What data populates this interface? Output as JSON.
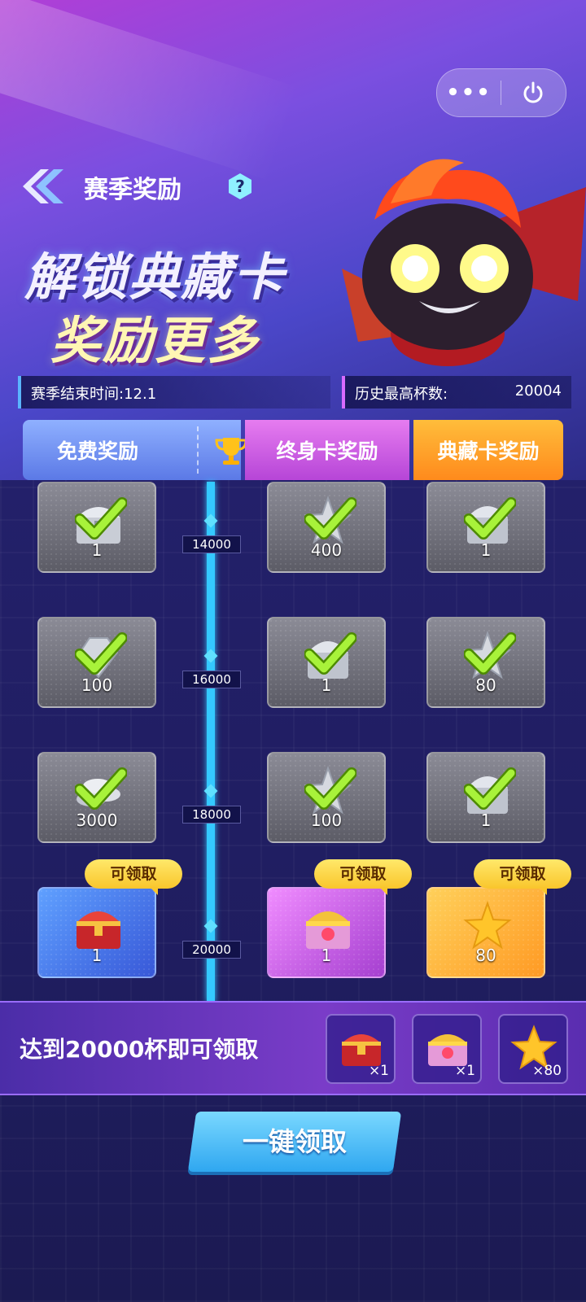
{
  "capsule": {
    "more_label": "•••",
    "power_icon": "power-icon"
  },
  "header": {
    "title": "赛季奖励",
    "help_label": "?"
  },
  "banner": {
    "line1": "解锁典藏卡",
    "line2": "奖励更多"
  },
  "info": {
    "season_end": "赛季结束时间:12.1",
    "best_label": "历史最高杯数:",
    "best_value": "20004"
  },
  "tabs": {
    "free": "免费奖励",
    "lifetime": "终身卡奖励",
    "collection": "典藏卡奖励",
    "trophy_icon": "trophy-icon"
  },
  "milestones": [
    {
      "label": "14000",
      "free": {
        "qty": "1",
        "icon": "silver-chest-icon"
      },
      "life": {
        "qty": "400",
        "icon": "silver-star-icon"
      },
      "col": {
        "qty": "1",
        "icon": "silver-ornate-chest-icon"
      }
    },
    {
      "label": "16000",
      "free": {
        "qty": "100",
        "icon": "silver-gem-icon"
      },
      "life": {
        "qty": "1",
        "icon": "silver-ornate-chest-icon"
      },
      "col": {
        "qty": "80",
        "icon": "silver-star-icon"
      }
    },
    {
      "label": "18000",
      "free": {
        "qty": "3000",
        "icon": "silver-coins-icon"
      },
      "life": {
        "qty": "100",
        "icon": "silver-star-icon"
      },
      "col": {
        "qty": "1",
        "icon": "silver-ornate-chest-icon"
      }
    },
    {
      "label": "20000",
      "free": {
        "qty": "1",
        "icon": "red-gold-chest-icon"
      },
      "life": {
        "qty": "1",
        "icon": "gold-ornate-chest-icon"
      },
      "col": {
        "qty": "80",
        "icon": "gold-star-icon"
      }
    }
  ],
  "claim_tag": "可领取",
  "bottom": {
    "text": "达到20000杯即可领取",
    "items": [
      {
        "count": "×1",
        "icon": "red-gold-chest-icon"
      },
      {
        "count": "×1",
        "icon": "gold-ornate-chest-icon"
      },
      {
        "count": "×80",
        "icon": "gold-star-icon"
      }
    ]
  },
  "claim_all": "一键领取",
  "colors": {
    "track": "#34c9ff",
    "free_tab": "#6f8ff0",
    "life_tab": "#c85be0",
    "col_tab": "#ff9f2a",
    "claim_yellow": "#f9c62c"
  }
}
